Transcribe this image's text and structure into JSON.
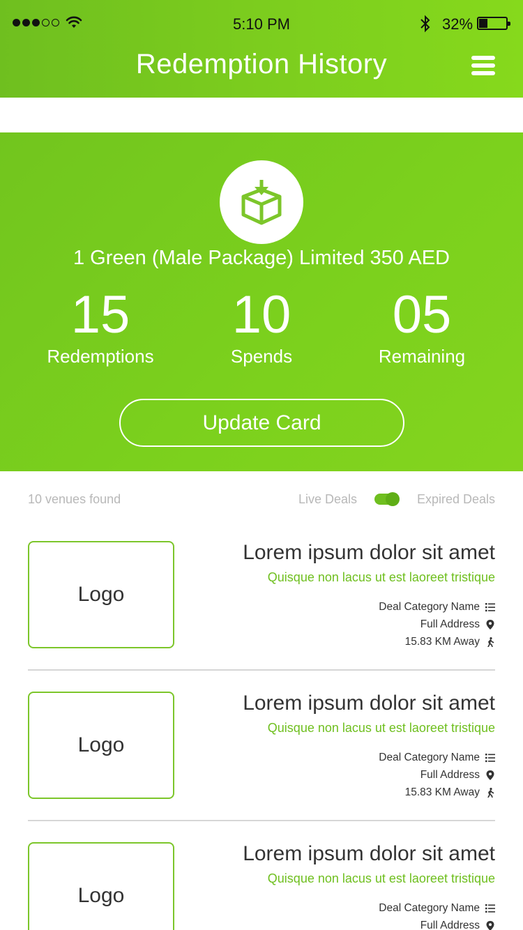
{
  "status_bar": {
    "time": "5:10 PM",
    "battery_percent": "32%",
    "battery_level": 0.32
  },
  "header": {
    "title": "Redemption History",
    "menu_icon": "hamburger-menu-icon"
  },
  "package": {
    "icon": "box-download-icon",
    "name": "1 Green (Male Package) Limited 350 AED",
    "stats": [
      {
        "value": "15",
        "label": "Redemptions"
      },
      {
        "value": "10",
        "label": "Spends"
      },
      {
        "value": "05",
        "label": "Remaining"
      }
    ],
    "update_button": "Update Card"
  },
  "filter": {
    "venues_found": "10 venues found",
    "live_label": "Live Deals",
    "expired_label": "Expired Deals",
    "toggle_state": "on"
  },
  "venues": [
    {
      "logo": "Logo",
      "title": "Lorem ipsum dolor sit amet",
      "subtitle": "Quisque non lacus ut est laoreet tristique",
      "category": "Deal Category Name",
      "address": "Full Address",
      "distance": "15.83 KM Away"
    },
    {
      "logo": "Logo",
      "title": "Lorem ipsum dolor sit amet",
      "subtitle": "Quisque non lacus ut est laoreet tristique",
      "category": "Deal Category Name",
      "address": "Full Address",
      "distance": "15.83 KM Away"
    },
    {
      "logo": "Logo",
      "title": "Lorem ipsum dolor sit amet",
      "subtitle": "Quisque non lacus ut est laoreet tristique",
      "category": "Deal Category Name",
      "address": "Full Address",
      "distance": ""
    }
  ],
  "colors": {
    "accent": "#7ccd1e",
    "accent_dark": "#6fbf1f",
    "muted_text": "#b8b8b8"
  }
}
